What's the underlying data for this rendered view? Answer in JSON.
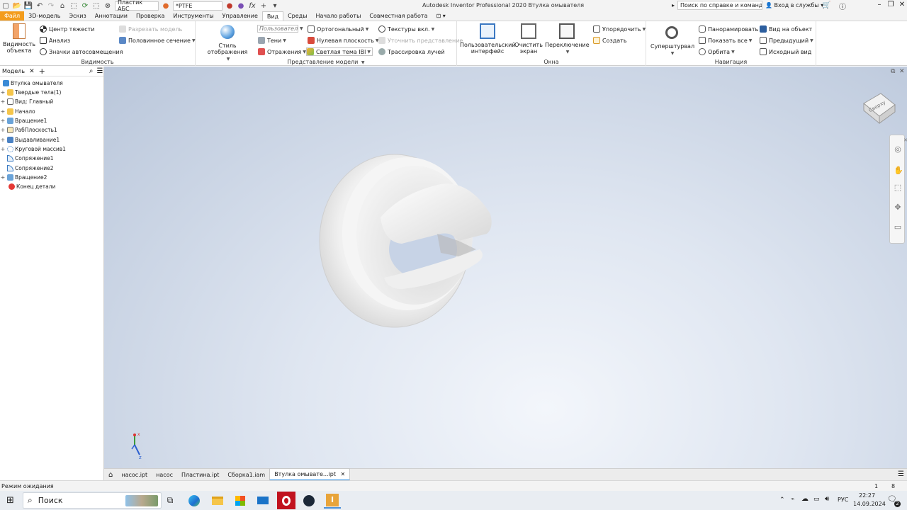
{
  "qat": {
    "material": "Пластик АБС",
    "appearance": "*PTFE",
    "fx": "fx"
  },
  "app_title": "Autodesk Inventor Professional 2020   Втулка омывателя",
  "help_search": "Поиск по справке и командам...",
  "signin": "Вход в службы",
  "tabs": [
    "Файл",
    "3D-модель",
    "Эскиз",
    "Аннотации",
    "Проверка",
    "Инструменты",
    "Управление",
    "Вид",
    "Среды",
    "Начало работы",
    "Совместная работа"
  ],
  "ribbon": {
    "visibility": {
      "title": "Видимость",
      "object_visibility": "Видимость объекта",
      "center_of_gravity": "Центр тяжести",
      "analysis": "Анализ",
      "autoconstraints": "Значки автосовмещения",
      "slice_model": "Разрезать модель",
      "half_section": "Половинное сечение"
    },
    "appearance": {
      "title": "Представление модели",
      "display_style": "Стиль отображения",
      "user_combo": "Пользовател",
      "orthographic": "Ортогональный",
      "shadows": "Тени",
      "ground_plane": "Нулевая плоскость",
      "reflections": "Отражения",
      "light_theme": "Светлая тема IBl",
      "textures": "Текстуры вкл.",
      "refine": "Уточнить представление",
      "ray_tracing": "Трассировка лучей"
    },
    "windows": {
      "title": "Окна",
      "user_interface": "Пользовательский интерфейс",
      "clean_screen": "Очистить экран",
      "switch": "Переключение",
      "arrange": "Упорядочить",
      "create": "Создать"
    },
    "navigate": {
      "title": "Навигация",
      "steering_wheel": "Суперштурвал",
      "pan": "Панорамировать",
      "zoom_all": "Показать все",
      "orbit": "Орбита",
      "look_at": "Вид на объект",
      "previous": "Предыдущий",
      "home": "Исходный вид"
    }
  },
  "browser": {
    "title": "Модель",
    "root": "Втулка омывателя",
    "items": [
      "Твердые тела(1)",
      "Вид: Главный",
      "Начало",
      "Вращение1",
      "РабПлоскость1",
      "Выдавливание1",
      "Круговой массив1",
      "Сопряжение1",
      "Сопряжение2",
      "Вращение2",
      "Конец детали"
    ]
  },
  "viewcube_label": "Сверху",
  "doc_tabs": [
    "насос.ipt",
    "насос",
    "Пластина.ipt",
    "Сборка1.iam",
    "Втулка омывате...ipt"
  ],
  "status": {
    "text": "Режим ожидания",
    "num1": "1",
    "num2": "8"
  },
  "taskbar": {
    "search": "Поиск",
    "lang": "РУС",
    "time": "22:27",
    "date": "14.09.2024",
    "notif_count": "2"
  },
  "colors": {
    "file_tab": "#f39c1d",
    "accent_blue": "#1e88e5",
    "error_red": "#e53935"
  }
}
